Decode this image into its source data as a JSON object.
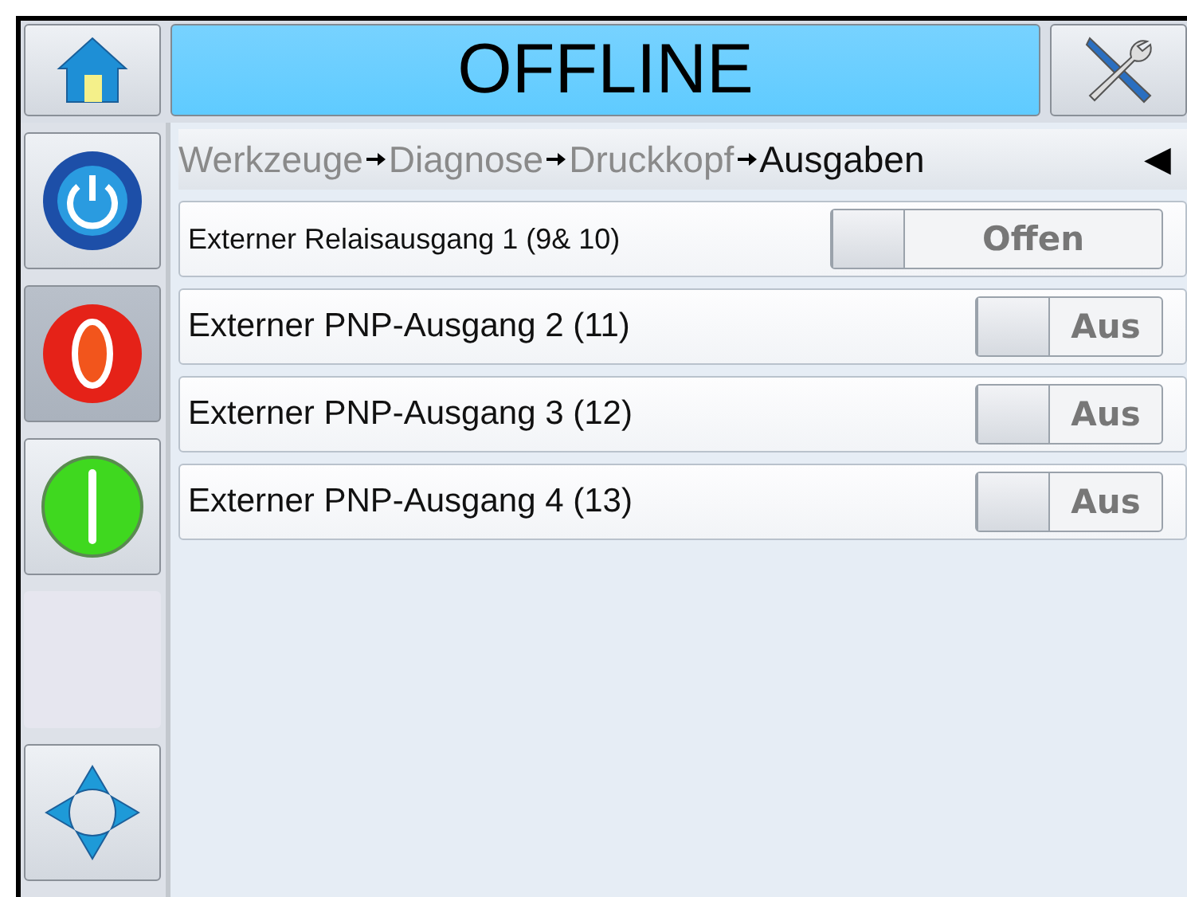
{
  "header": {
    "status": "OFFLINE"
  },
  "side_buttons": [
    {
      "kind": "power",
      "selected": false
    },
    {
      "kind": "stop",
      "selected": true
    },
    {
      "kind": "start",
      "selected": false
    },
    {
      "kind": "empty",
      "selected": false
    },
    {
      "kind": "navigate",
      "selected": false
    }
  ],
  "breadcrumb": {
    "items": [
      {
        "label": "Werkzeuge",
        "current": false
      },
      {
        "label": "Diagnose",
        "current": false
      },
      {
        "label": "Druckkopf",
        "current": false
      },
      {
        "label": "Ausgaben",
        "current": true
      }
    ],
    "back": "◀"
  },
  "outputs": [
    {
      "label": "Externer Relaisausgang 1 (9& 10)",
      "state": "Offen",
      "on": false,
      "wide": true
    },
    {
      "label": "Externer PNP-Ausgang 2 (11)",
      "state": "Aus",
      "on": false,
      "wide": false
    },
    {
      "label": "Externer PNP-Ausgang 3 (12)",
      "state": "Aus",
      "on": false,
      "wide": false
    },
    {
      "label": "Externer PNP-Ausgang 4 (13)",
      "state": "Aus",
      "on": false,
      "wide": false
    }
  ]
}
